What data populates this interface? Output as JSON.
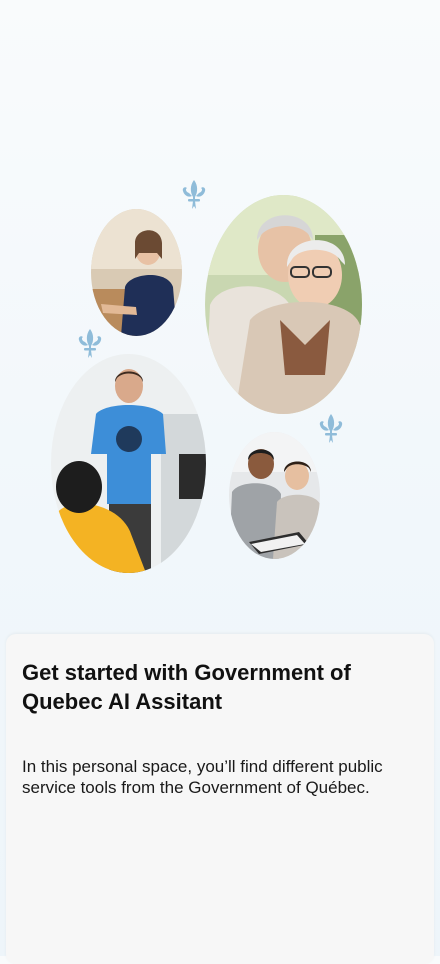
{
  "onboarding": {
    "title": "Get started with Government of Quebec AI Assitant",
    "description": "In this personal space, you’ll find different public service tools from the Government of Québec."
  },
  "photos": [
    {
      "name": "photo-woman-at-desk"
    },
    {
      "name": "photo-senior-couple"
    },
    {
      "name": "photo-teacher-classroom"
    },
    {
      "name": "photo-students-laptop"
    }
  ],
  "decorations": {
    "icon": "fleur-de-lis-icon",
    "color": "#8fbcd9"
  }
}
